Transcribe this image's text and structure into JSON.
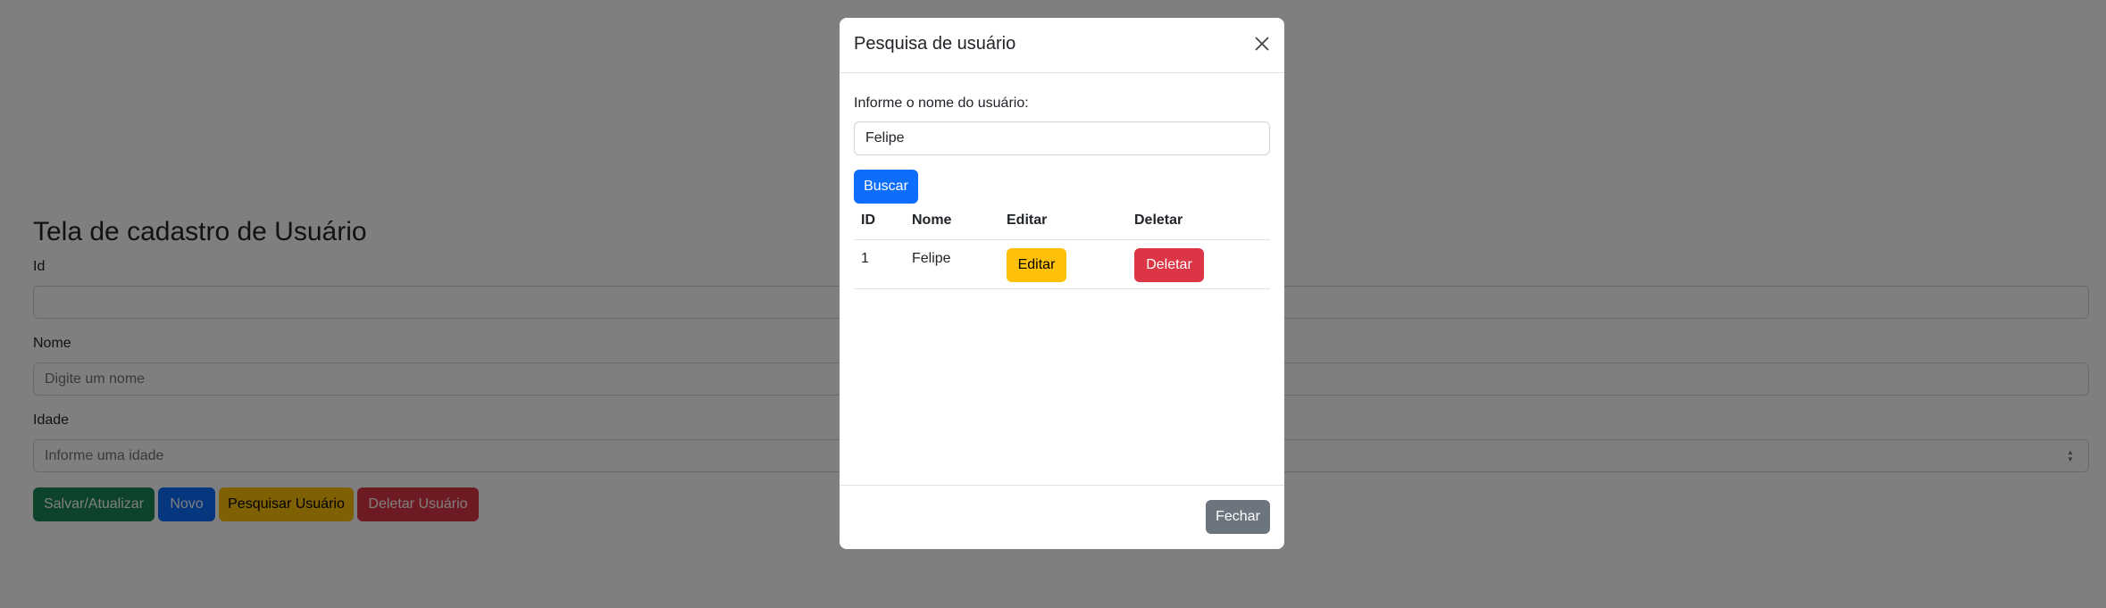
{
  "page": {
    "title": "Tela de cadastro de Usuário",
    "fields": {
      "id_label": "Id",
      "id_value": "",
      "nome_label": "Nome",
      "nome_placeholder": "Digite um nome",
      "idade_label": "Idade",
      "idade_placeholder": "Informe uma idade"
    },
    "buttons": {
      "save": "Salvar/Atualizar",
      "new": "Novo",
      "search_user": "Pesquisar Usuário",
      "delete_user": "Deletar Usuário"
    }
  },
  "modal": {
    "title": "Pesquisa de usuário",
    "search_label": "Informe o nome do usuário:",
    "search_value": "Felipe",
    "search_button": "Buscar",
    "table": {
      "headers": [
        "ID",
        "Nome",
        "Editar",
        "Deletar"
      ],
      "rows": [
        {
          "id": "1",
          "nome": "Felipe",
          "edit_label": "Editar",
          "delete_label": "Deletar"
        }
      ]
    },
    "close_button": "Fechar"
  },
  "colors": {
    "success": "#198754",
    "primary": "#0d6efd",
    "warning": "#ffc107",
    "danger": "#dc3545",
    "secondary": "#6c757d"
  }
}
